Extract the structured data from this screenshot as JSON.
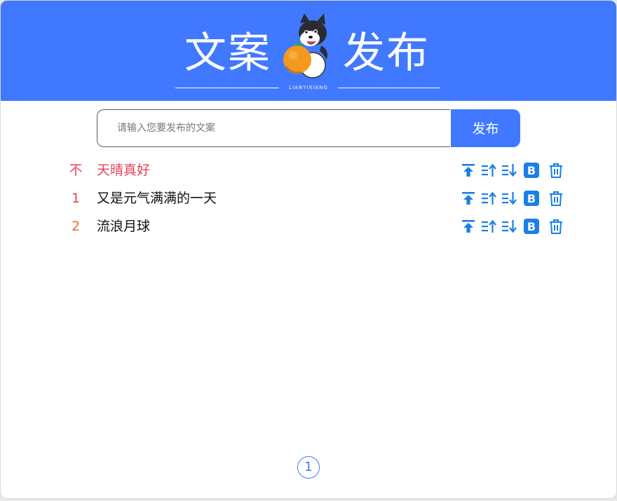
{
  "header": {
    "title_left": "文案",
    "title_right": "发布",
    "subtitle": "LIANYIXIANG",
    "background_color": "#4079ff"
  },
  "search": {
    "placeholder": "请输入您要发布的文案",
    "value": "",
    "button_label": "发布"
  },
  "items": [
    {
      "rank": "不",
      "rank_color": "#e8415b",
      "text": "天晴真好",
      "text_color": "#e8415b",
      "pinned": true
    },
    {
      "rank": "1",
      "rank_color": "#e8415b",
      "text": "又是元气满满的一天",
      "text_color": "#111111",
      "pinned": false
    },
    {
      "rank": "2",
      "rank_color": "#f06a22",
      "text": "流浪月球",
      "text_color": "#111111",
      "pinned": false
    }
  ],
  "actions": [
    "pin-top-icon",
    "move-up-icon",
    "move-down-icon",
    "bold-icon",
    "delete-icon"
  ],
  "action_color": "#1a7fe8",
  "pagination": {
    "current_page": "1"
  }
}
